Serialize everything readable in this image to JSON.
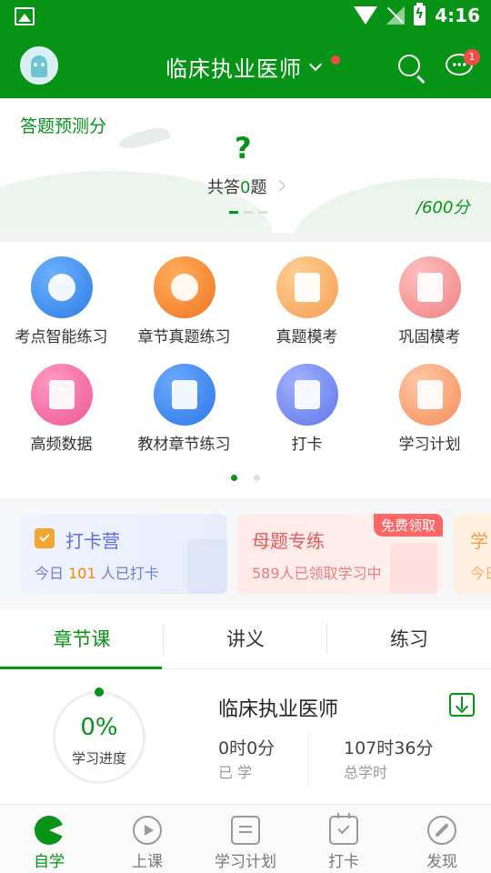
{
  "status_bar": {
    "time": "4:16"
  },
  "header": {
    "title": "临床执业医师",
    "message_badge": "1"
  },
  "predict": {
    "title": "答题预测分",
    "score": "?",
    "answered_prefix": "共答",
    "answered_count": "0",
    "answered_suffix": "题",
    "total": "/600分"
  },
  "features": [
    {
      "label": "考点智能练习",
      "icon": "clock-lightning-icon",
      "color": "#3d8ff0"
    },
    {
      "label": "章节真题练习",
      "icon": "head-gear-icon",
      "color": "#f5882c"
    },
    {
      "label": "真题模考",
      "icon": "folder-list-icon",
      "color": "#f7a95a"
    },
    {
      "label": "巩固模考",
      "icon": "document-check-icon",
      "color": "#f58e8e"
    },
    {
      "label": "高频数据",
      "icon": "chart-book-icon",
      "color": "#f06aa0"
    },
    {
      "label": "教材章节练习",
      "icon": "medical-book-icon",
      "color": "#3a86ee"
    },
    {
      "label": "打卡",
      "icon": "calendar-check-icon",
      "color": "#6f86ee"
    },
    {
      "label": "学习计划",
      "icon": "clipboard-icon",
      "color": "#f9a273"
    }
  ],
  "promos": {
    "checkin": {
      "title": "打卡营",
      "sub_prefix": "今日 ",
      "sub_count": "101",
      "sub_suffix": " 人已打卡"
    },
    "mother": {
      "title": "母题专练",
      "sub": "589人已领取学习中",
      "ribbon": "免费领取"
    },
    "third": {
      "title": "学",
      "sub": "今日"
    }
  },
  "tabs": [
    "章节课",
    "讲义",
    "练习"
  ],
  "progress": {
    "percent": "0%",
    "percent_value": 0,
    "label": "学习进度",
    "course_title": "临床执业医师",
    "learned_value": "0时0分",
    "learned_label": "已 学",
    "total_value": "107时36分",
    "total_label": "总学时"
  },
  "bottom_nav": [
    "自学",
    "上课",
    "学习计划",
    "打卡",
    "发现"
  ],
  "colors": {
    "brand": "#069316",
    "badge": "#f44a4a"
  }
}
